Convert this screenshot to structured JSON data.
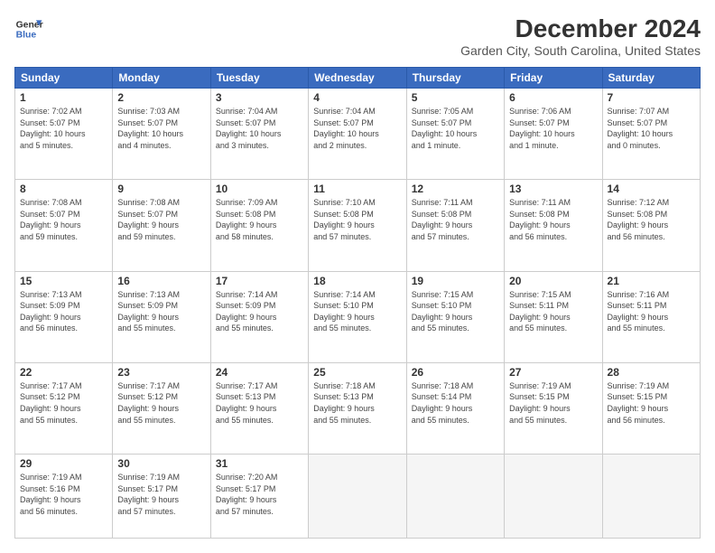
{
  "header": {
    "logo_line1": "General",
    "logo_line2": "Blue",
    "month": "December 2024",
    "location": "Garden City, South Carolina, United States"
  },
  "weekdays": [
    "Sunday",
    "Monday",
    "Tuesday",
    "Wednesday",
    "Thursday",
    "Friday",
    "Saturday"
  ],
  "weeks": [
    [
      {
        "day": "1",
        "info": "Sunrise: 7:02 AM\nSunset: 5:07 PM\nDaylight: 10 hours\nand 5 minutes."
      },
      {
        "day": "2",
        "info": "Sunrise: 7:03 AM\nSunset: 5:07 PM\nDaylight: 10 hours\nand 4 minutes."
      },
      {
        "day": "3",
        "info": "Sunrise: 7:04 AM\nSunset: 5:07 PM\nDaylight: 10 hours\nand 3 minutes."
      },
      {
        "day": "4",
        "info": "Sunrise: 7:04 AM\nSunset: 5:07 PM\nDaylight: 10 hours\nand 2 minutes."
      },
      {
        "day": "5",
        "info": "Sunrise: 7:05 AM\nSunset: 5:07 PM\nDaylight: 10 hours\nand 1 minute."
      },
      {
        "day": "6",
        "info": "Sunrise: 7:06 AM\nSunset: 5:07 PM\nDaylight: 10 hours\nand 1 minute."
      },
      {
        "day": "7",
        "info": "Sunrise: 7:07 AM\nSunset: 5:07 PM\nDaylight: 10 hours\nand 0 minutes."
      }
    ],
    [
      {
        "day": "8",
        "info": "Sunrise: 7:08 AM\nSunset: 5:07 PM\nDaylight: 9 hours\nand 59 minutes."
      },
      {
        "day": "9",
        "info": "Sunrise: 7:08 AM\nSunset: 5:07 PM\nDaylight: 9 hours\nand 59 minutes."
      },
      {
        "day": "10",
        "info": "Sunrise: 7:09 AM\nSunset: 5:08 PM\nDaylight: 9 hours\nand 58 minutes."
      },
      {
        "day": "11",
        "info": "Sunrise: 7:10 AM\nSunset: 5:08 PM\nDaylight: 9 hours\nand 57 minutes."
      },
      {
        "day": "12",
        "info": "Sunrise: 7:11 AM\nSunset: 5:08 PM\nDaylight: 9 hours\nand 57 minutes."
      },
      {
        "day": "13",
        "info": "Sunrise: 7:11 AM\nSunset: 5:08 PM\nDaylight: 9 hours\nand 56 minutes."
      },
      {
        "day": "14",
        "info": "Sunrise: 7:12 AM\nSunset: 5:08 PM\nDaylight: 9 hours\nand 56 minutes."
      }
    ],
    [
      {
        "day": "15",
        "info": "Sunrise: 7:13 AM\nSunset: 5:09 PM\nDaylight: 9 hours\nand 56 minutes."
      },
      {
        "day": "16",
        "info": "Sunrise: 7:13 AM\nSunset: 5:09 PM\nDaylight: 9 hours\nand 55 minutes."
      },
      {
        "day": "17",
        "info": "Sunrise: 7:14 AM\nSunset: 5:09 PM\nDaylight: 9 hours\nand 55 minutes."
      },
      {
        "day": "18",
        "info": "Sunrise: 7:14 AM\nSunset: 5:10 PM\nDaylight: 9 hours\nand 55 minutes."
      },
      {
        "day": "19",
        "info": "Sunrise: 7:15 AM\nSunset: 5:10 PM\nDaylight: 9 hours\nand 55 minutes."
      },
      {
        "day": "20",
        "info": "Sunrise: 7:15 AM\nSunset: 5:11 PM\nDaylight: 9 hours\nand 55 minutes."
      },
      {
        "day": "21",
        "info": "Sunrise: 7:16 AM\nSunset: 5:11 PM\nDaylight: 9 hours\nand 55 minutes."
      }
    ],
    [
      {
        "day": "22",
        "info": "Sunrise: 7:17 AM\nSunset: 5:12 PM\nDaylight: 9 hours\nand 55 minutes."
      },
      {
        "day": "23",
        "info": "Sunrise: 7:17 AM\nSunset: 5:12 PM\nDaylight: 9 hours\nand 55 minutes."
      },
      {
        "day": "24",
        "info": "Sunrise: 7:17 AM\nSunset: 5:13 PM\nDaylight: 9 hours\nand 55 minutes."
      },
      {
        "day": "25",
        "info": "Sunrise: 7:18 AM\nSunset: 5:13 PM\nDaylight: 9 hours\nand 55 minutes."
      },
      {
        "day": "26",
        "info": "Sunrise: 7:18 AM\nSunset: 5:14 PM\nDaylight: 9 hours\nand 55 minutes."
      },
      {
        "day": "27",
        "info": "Sunrise: 7:19 AM\nSunset: 5:15 PM\nDaylight: 9 hours\nand 55 minutes."
      },
      {
        "day": "28",
        "info": "Sunrise: 7:19 AM\nSunset: 5:15 PM\nDaylight: 9 hours\nand 56 minutes."
      }
    ],
    [
      {
        "day": "29",
        "info": "Sunrise: 7:19 AM\nSunset: 5:16 PM\nDaylight: 9 hours\nand 56 minutes."
      },
      {
        "day": "30",
        "info": "Sunrise: 7:19 AM\nSunset: 5:17 PM\nDaylight: 9 hours\nand 57 minutes."
      },
      {
        "day": "31",
        "info": "Sunrise: 7:20 AM\nSunset: 5:17 PM\nDaylight: 9 hours\nand 57 minutes."
      },
      {
        "day": "",
        "info": ""
      },
      {
        "day": "",
        "info": ""
      },
      {
        "day": "",
        "info": ""
      },
      {
        "day": "",
        "info": ""
      }
    ]
  ]
}
